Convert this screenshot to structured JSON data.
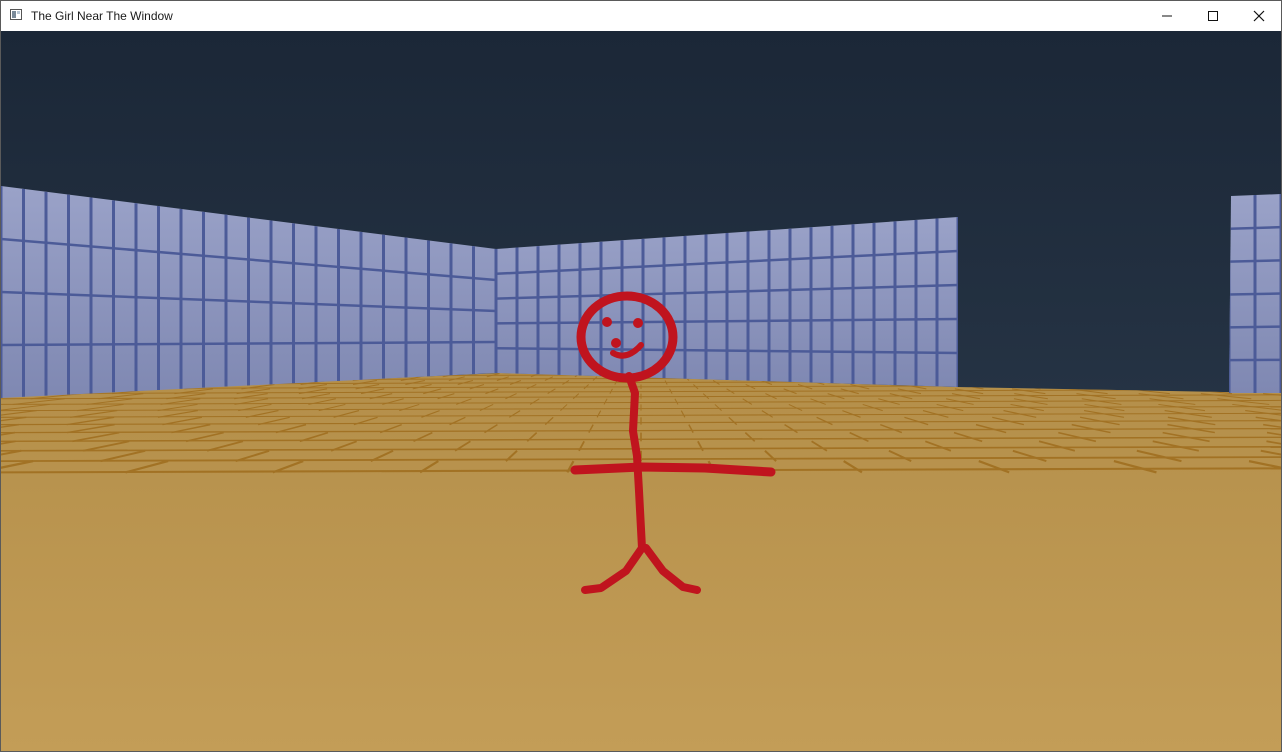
{
  "window": {
    "title": "The Girl Near The Window",
    "app_icon": "window-app-icon",
    "controls": [
      {
        "name": "minimize-button",
        "icon": "minimize-icon"
      },
      {
        "name": "maximize-button",
        "icon": "maximize-icon"
      },
      {
        "name": "close-button",
        "icon": "close-icon"
      }
    ]
  },
  "scene": {
    "sky_top_color": "#1b2737",
    "sky_bottom_color": "#3a4147",
    "wall_color": "#8b93ba",
    "wall_line_color": "#4d5c9a",
    "floor_color": "#b99550",
    "floor_line_color": "#a07020",
    "character_color": "#c0141e",
    "character": "red-stick-figure"
  }
}
